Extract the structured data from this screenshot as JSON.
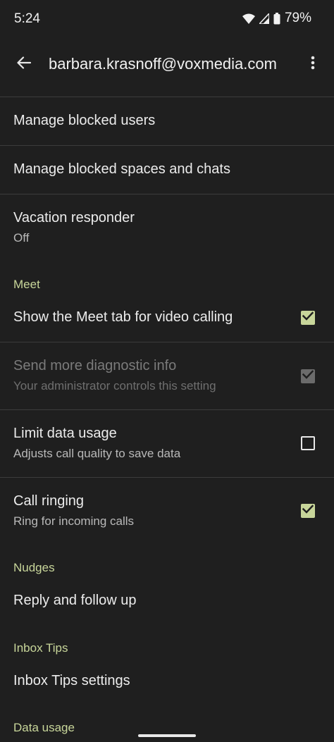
{
  "status_bar": {
    "time": "5:24",
    "battery_percent": "79%",
    "icons": [
      "wifi-icon",
      "cell-signal-icon",
      "battery-icon"
    ]
  },
  "app_bar": {
    "title": "barbara.krasnoff@voxmedia.com",
    "back_icon": "arrow-back-icon",
    "overflow_icon": "more-vert-icon"
  },
  "colors": {
    "background": "#1f1f1f",
    "accent": "#c8d69a",
    "divider": "#3c3c3c"
  },
  "items": {
    "blocked_users": {
      "title": "Manage blocked users"
    },
    "blocked_spaces": {
      "title": "Manage blocked spaces and chats"
    },
    "vacation": {
      "title": "Vacation responder",
      "subtitle": "Off"
    }
  },
  "meet": {
    "header": "Meet",
    "show_tab": {
      "title": "Show the Meet tab for video calling",
      "checked": true
    },
    "diagnostic": {
      "title": "Send more diagnostic info",
      "subtitle": "Your administrator controls this setting",
      "checked": true,
      "enabled": false
    },
    "limit_data": {
      "title": "Limit data usage",
      "subtitle": "Adjusts call quality to save data",
      "checked": false
    },
    "call_ringing": {
      "title": "Call ringing",
      "subtitle": "Ring for incoming calls",
      "checked": true
    }
  },
  "nudges": {
    "header": "Nudges",
    "reply_follow": {
      "title": "Reply and follow up"
    }
  },
  "inbox_tips": {
    "header": "Inbox Tips",
    "settings": {
      "title": "Inbox Tips settings"
    }
  },
  "data_usage": {
    "header": "Data usage"
  }
}
